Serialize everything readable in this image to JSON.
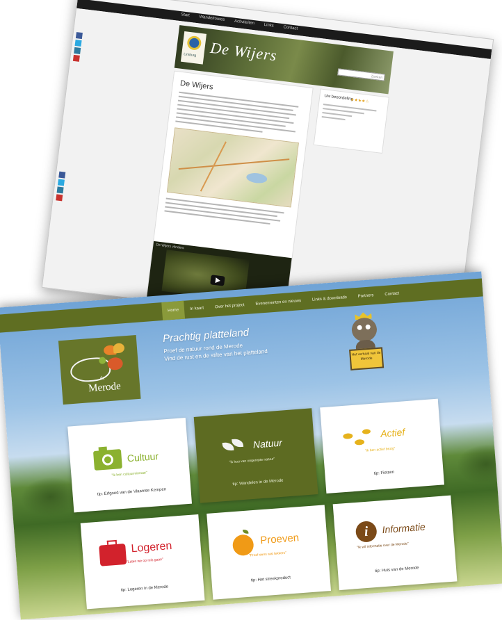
{
  "screen1": {
    "nav": [
      "Start",
      "Wandelroutes",
      "Activiteiten",
      "Links",
      "Contact"
    ],
    "banner_title": "De Wijers",
    "logo_text": "Limburg",
    "search_placeholder": "Zoeken",
    "article_heading": "De Wijers",
    "video_title": "De Wijers vlinders",
    "sidebar_title": "Uw beoordeling",
    "sidebar_stars": "★★★★☆",
    "share_colors": [
      "#3b5998",
      "#2ba9e1",
      "#2d7a9e",
      "#c8322e"
    ]
  },
  "screen2": {
    "nav": [
      "Home",
      "In kaart",
      "Over het project",
      "Evenementen en nieuws",
      "Links & downloads",
      "Partners",
      "Contact"
    ],
    "nav_active_index": 0,
    "logo_small": "de",
    "logo_big": "Merode",
    "tagline_title": "Prachtig platteland",
    "tagline_line1": "Proef de natuur rond de Merode",
    "tagline_line2": "Vind de rust en de stilte van het platteland",
    "mascot_sign": "Het verhaal van de Merode",
    "cards": {
      "cultuur": {
        "title": "Cultuur",
        "subtitle": "\"ik ben cultuurminnaar\"",
        "footer": "tip: Erfgoed van de Vlaamse Kempen"
      },
      "natuur": {
        "title": "Natuur",
        "subtitle": "\"ik hou van ongerepte natuur\"",
        "footer": "tip: Wandelen in de Merode"
      },
      "actief": {
        "title": "Actief",
        "subtitle": "\"ik ben actief bezig\"",
        "footer": "tip: Fietsen"
      },
      "logeren": {
        "title": "Logeren",
        "subtitle": "\"Laten we op reis gaan\"",
        "footer": "tip: Logeren in de Merode"
      },
      "proeven": {
        "title": "Proeven",
        "subtitle": "\"Proef eens wat lekkers\"",
        "footer": "tip: Het streekproduct"
      },
      "informatie": {
        "title": "Informatie",
        "subtitle": "\"Ik wil informatie over de Merode\"",
        "footer": "tip: Huis van de Merode"
      }
    },
    "colors": {
      "brand_green": "#5f6e22",
      "cultuur": "#8bb12f",
      "actief": "#e6b21c",
      "logeren": "#d2222c",
      "proeven": "#f09a16",
      "informatie": "#7b4a18"
    }
  }
}
